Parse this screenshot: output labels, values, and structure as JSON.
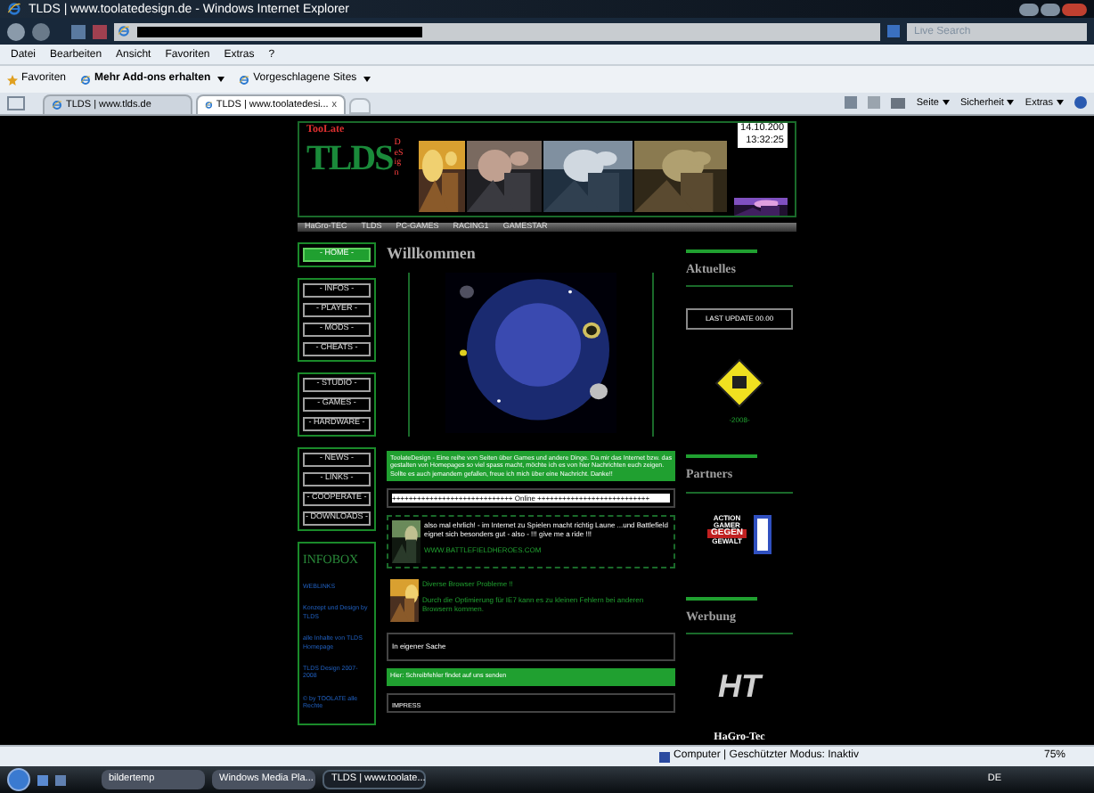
{
  "window": {
    "title": "TLDS | www.toolatedesign.de - Windows Internet Explorer"
  },
  "search": {
    "placeholder": "Live Search"
  },
  "menu": [
    "Datei",
    "Bearbeiten",
    "Ansicht",
    "Favoriten",
    "Extras",
    "?"
  ],
  "favorites_bar": {
    "favorites": "Favoriten",
    "items": [
      "Mehr Add-ons erhalten",
      "Vorgeschlagene Sites"
    ]
  },
  "tabs": [
    {
      "label": "TLDS | www.tlds.de",
      "selected": false
    },
    {
      "label": "TLDS | www.toolatedesi...",
      "selected": true
    }
  ],
  "tab_close": "x",
  "command_bar": [
    "Seite",
    "Sicherheit",
    "Extras"
  ],
  "site": {
    "logo": {
      "top": "TooLate",
      "main": "TLDS",
      "side": "DeSign"
    },
    "date": "14.10.200",
    "time": "13:32:25",
    "nav_links": [
      "HaGro-TEC",
      "TLDS",
      "PC-GAMES",
      "RACING1",
      "GAMESTAR"
    ],
    "side_groups": [
      [
        {
          "label": "- HOME -",
          "selected": true
        }
      ],
      [
        {
          "label": "- INFOS -",
          "selected": false
        },
        {
          "label": "- PLAYER -",
          "selected": false
        },
        {
          "label": "- MODS -",
          "selected": false
        },
        {
          "label": "- CHEATS -",
          "selected": false
        }
      ],
      [
        {
          "label": "- STUDIO -",
          "selected": false
        },
        {
          "label": "- GAMES -",
          "selected": false
        },
        {
          "label": "- HARDWARE -",
          "selected": false
        }
      ],
      [
        {
          "label": "- NEWS -",
          "selected": false
        },
        {
          "label": "- LINKS -",
          "selected": false
        },
        {
          "label": "- COOPERATE -",
          "selected": false
        },
        {
          "label": "- DOWNLOADS -",
          "selected": false
        }
      ]
    ],
    "infobox": {
      "title": "INFOBOX",
      "links": [
        "WEBLINKS",
        "Konzept und Design by TLDS",
        "alle Inhalte von TLDS Homepage",
        "TLDS Design 2007-2008",
        "© by TOOLATE alle Rechte"
      ]
    },
    "heading": "Willkommen",
    "intro": "ToolateDesign - Eine reihe von Seiten über Games und andere Dinge. Da mir das Internet bzw. das gestalten von Homepages so viel spass macht, möchte ich es von hier Nachrichten euch zeigen. Sollte es auch jemandem gefallen, freue ich mich über eine Nachricht. Danke!!",
    "online": "+++++++++++++++++++++++++++++  Online  +++++++++++++++++++++++++++",
    "news": [
      {
        "text": "also mal ehrlich! - im Internet zu Spielen macht richtig Laune ...und Battlefield eignet sich besonders gut - also - !!! give me a ride !!!",
        "link": "WWW.BATTLEFIELDHEROES.COM"
      },
      {
        "title": "Diverse Browser Probleme !!",
        "text": "Durch die Optimierung für IE7 kann es zu kleinen Fehlern bei anderen Browsern kommen."
      }
    ],
    "own_matter": "In eigener Sache",
    "notice": "Hier: Schreibfehler findet auf uns senden",
    "cut_box": "IMPRESS",
    "right": {
      "news_title": "Aktuelles",
      "update": "LAST UPDATE 00.00",
      "year": "-2008-",
      "partners_title": "Partners",
      "partner_logo": [
        "ACTION",
        "GAMER",
        "GEGEN",
        "GEWALT"
      ],
      "ad_title": "Werbung",
      "ad_logo": "HT",
      "ad_name": "HaGro-Tec"
    }
  },
  "status_bar": {
    "zone": "Computer | Geschützter Modus: Inaktiv",
    "zoom": "75%"
  },
  "taskbar": {
    "items": [
      {
        "label": "bildertemp",
        "selected": false
      },
      {
        "label": "Windows Media Pla...",
        "selected": false
      },
      {
        "label": "TLDS | www.toolate...",
        "selected": true
      }
    ],
    "lang": "DE"
  }
}
